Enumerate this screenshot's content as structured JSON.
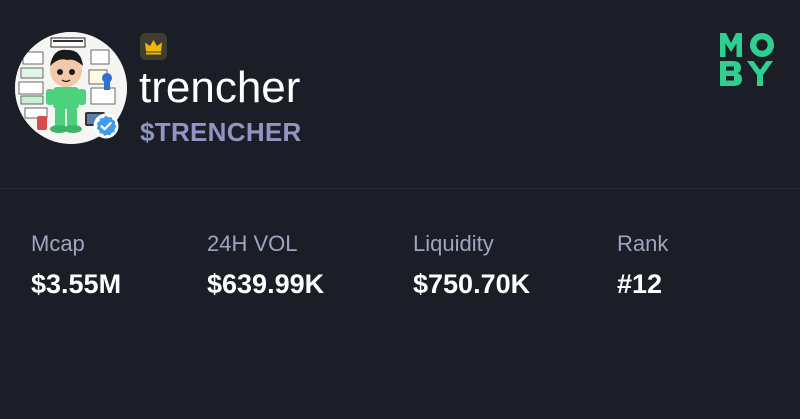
{
  "token": {
    "name": "trencher",
    "ticker": "$TRENCHER",
    "verified": true,
    "tier_icon": "crown-icon",
    "accent_color": "#8f96c4"
  },
  "brand": {
    "logo_text": "MOBY",
    "color": "#2ecf8f"
  },
  "stats": [
    {
      "label": "Mcap",
      "value": "$3.55M"
    },
    {
      "label": "24H VOL",
      "value": "$639.99K"
    },
    {
      "label": "Liquidity",
      "value": "$750.70K"
    },
    {
      "label": "Rank",
      "value": "#12"
    }
  ],
  "colors": {
    "background": "#1b1e26",
    "label": "#9da6bf",
    "value": "#ffffff",
    "crown": "#f2b705",
    "verified": "#3d9cf0"
  }
}
